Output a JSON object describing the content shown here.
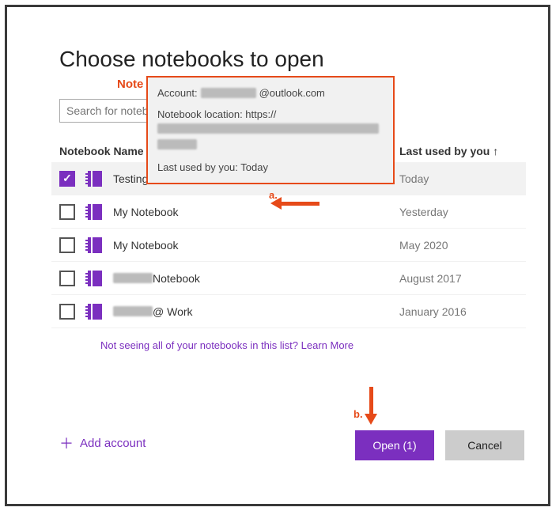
{
  "title": "Choose notebooks to open",
  "annotation_word": "Note",
  "search": {
    "placeholder": "Search for notebook"
  },
  "headers": {
    "name": "Notebook Name",
    "last_used": "Last used by you ↑"
  },
  "tooltip": {
    "account_label": "Account:",
    "account_value": "@outlook.com",
    "location_label": "Notebook location: https://",
    "last_used": "Last used by you: Today"
  },
  "rows": [
    {
      "checked": true,
      "name": "Testing from Personal Account",
      "date": "Today",
      "highlight": true
    },
    {
      "checked": false,
      "name": "My Notebook",
      "date": "Yesterday",
      "highlight": false
    },
    {
      "checked": false,
      "name": "My Notebook",
      "date": "May 2020",
      "highlight": false
    },
    {
      "checked": false,
      "name_suffix": " Notebook",
      "date": "August 2017",
      "highlight": false,
      "redact_prefix": true
    },
    {
      "checked": false,
      "name_suffix": " @ Work",
      "date": "January 2016",
      "highlight": false,
      "redact_prefix": true
    }
  ],
  "footer_link": "Not seeing all of your notebooks in this list? Learn More",
  "add_account": "Add account",
  "buttons": {
    "open": "Open (1)",
    "cancel": "Cancel"
  },
  "annotations": {
    "a": "a.",
    "b": "b."
  }
}
